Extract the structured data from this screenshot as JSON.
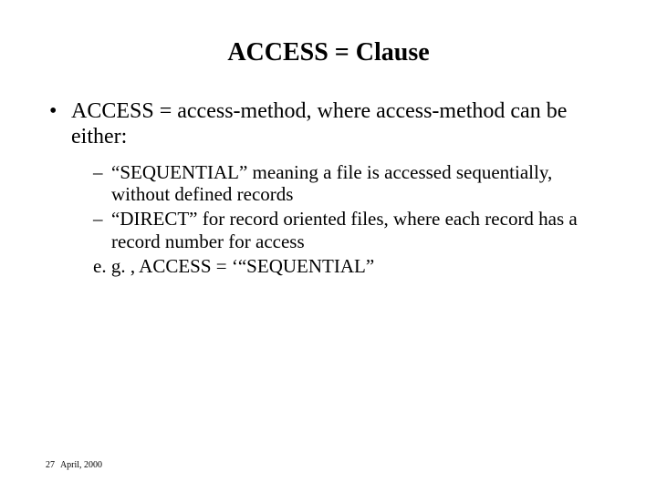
{
  "title": "ACCESS = Clause",
  "bullet": {
    "text": "ACCESS = access-method, where access-method can be either:",
    "subs": [
      "“SEQUENTIAL” meaning a file is accessed sequentially, without defined records",
      "“DIRECT” for record oriented files, where each record has a record number for access"
    ],
    "example": "e. g. , ACCESS = ‘“SEQUENTIAL”"
  },
  "footer": {
    "page": "27",
    "date": "April, 2000"
  }
}
